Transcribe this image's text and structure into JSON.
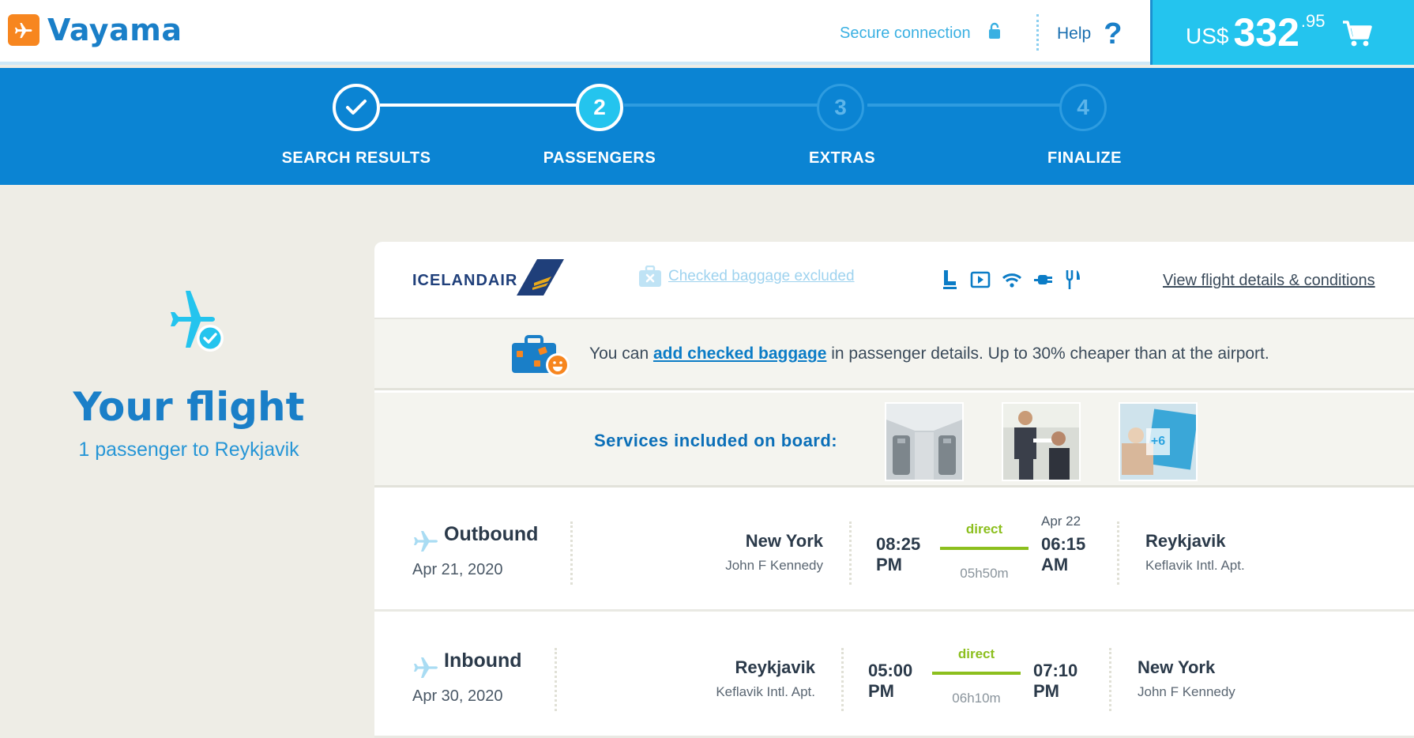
{
  "header": {
    "brand": "Vayama",
    "secure_label": "Secure connection",
    "help_label": "Help",
    "help_symbol": "?",
    "cart": {
      "currency": "US$",
      "amount": "332",
      "cents": ".95"
    }
  },
  "steps": [
    {
      "number": "✓",
      "label": "SEARCH RESULTS",
      "state": "done"
    },
    {
      "number": "2",
      "label": "PASSENGERS",
      "state": "active"
    },
    {
      "number": "3",
      "label": "EXTRAS",
      "state": "upcoming"
    },
    {
      "number": "4",
      "label": "FINALIZE",
      "state": "upcoming"
    }
  ],
  "sidebar": {
    "title": "Your flight",
    "subtitle": "1 passenger to Reykjavik"
  },
  "flight": {
    "airline": "ICELANDAIR",
    "baggage_note": "Checked baggage excluded",
    "amenities": [
      "seat-icon",
      "entertainment-icon",
      "wifi-icon",
      "power-plug-icon",
      "meal-icon"
    ],
    "details_link": "View flight details & conditions",
    "promo": {
      "before": "You can ",
      "link": "add checked baggage",
      "after": " in passenger details. Up to 30% cheaper than at the airport."
    },
    "services_label": "Services included on board:",
    "services_more": "+6",
    "outbound": {
      "direction": "Outbound",
      "date": "Apr 21, 2020",
      "from_city": "New York",
      "from_airport": "John F Kennedy",
      "depart_time": "08:25",
      "depart_ampm": "PM",
      "stops": "direct",
      "duration": "05h50m",
      "arrive_date": "Apr 22",
      "arrive_time": "06:15",
      "arrive_ampm": "AM",
      "to_city": "Reykjavik",
      "to_airport": "Keflavik Intl. Apt."
    },
    "inbound": {
      "direction": "Inbound",
      "date": "Apr 30, 2020",
      "from_city": "Reykjavik",
      "from_airport": "Keflavik Intl. Apt.",
      "depart_time": "05:00",
      "depart_ampm": "PM",
      "stops": "direct",
      "duration": "06h10m",
      "arrive_time": "07:10",
      "arrive_ampm": "PM",
      "to_city": "New York",
      "to_airport": "John F Kennedy"
    }
  },
  "colors": {
    "brand_blue": "#1a7fc8",
    "stepper_bg": "#0b84d3",
    "cart_bg": "#24c4ee",
    "accent_green": "#8cbf1e",
    "accent_orange": "#f7861f"
  }
}
